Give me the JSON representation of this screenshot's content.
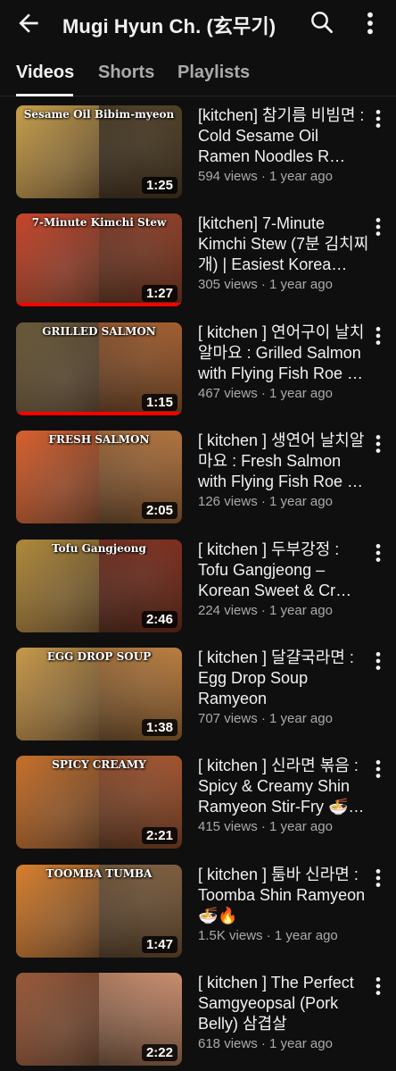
{
  "header": {
    "back_icon": "arrow-back-icon",
    "title": "Mugi Hyun Ch. (玄무기)",
    "search_icon": "search-icon",
    "more_icon": "more-vert-icon"
  },
  "tabs": [
    {
      "label": "Videos",
      "active": true
    },
    {
      "label": "Shorts",
      "active": false
    },
    {
      "label": "Playlists",
      "active": false
    }
  ],
  "videos": [
    {
      "thumb_text": "Sesame Oil Bibim-myeon",
      "duration": "1:25",
      "watched_fraction": 0.0,
      "title": "[kitchen] 참기름 비빔면 : Cold Sesame Oil Ramen Noodles R…",
      "views": "594 views",
      "age": "1 year ago",
      "colors": [
        "#c8a04a",
        "#4a3a22"
      ]
    },
    {
      "thumb_text": "7-Minute Kimchi Stew",
      "duration": "1:27",
      "watched_fraction": 1.0,
      "title": "[kitchen] 7-Minute Kimchi Stew (7분 김치찌개) | Easiest Korea…",
      "views": "305 views",
      "age": "1 year ago",
      "colors": [
        "#c8452a",
        "#8a3a22"
      ]
    },
    {
      "thumb_text": "GRILLED SALMON",
      "duration": "1:15",
      "watched_fraction": 1.0,
      "title": "[ kitchen ] 연어구이 날치알마요 : Grilled Salmon with Flying Fish Roe …",
      "views": "467 views",
      "age": "1 year ago",
      "colors": [
        "#6a5a3a",
        "#a05a2a"
      ]
    },
    {
      "thumb_text": "FRESH SALMON",
      "duration": "2:05",
      "watched_fraction": 0.0,
      "title": "[ kitchen ] 생연어 날치알마요 : Fresh Salmon with Flying Fish Roe …",
      "views": "126 views",
      "age": "1 year ago",
      "colors": [
        "#d9602e",
        "#b0703a"
      ]
    },
    {
      "thumb_text": "Tofu Gangjeong",
      "duration": "2:46",
      "watched_fraction": 0.0,
      "title": "[ kitchen ] 두부강정 : Tofu Gangjeong – Korean Sweet & Cr…",
      "views": "224 views",
      "age": "1 year ago",
      "colors": [
        "#b08a3a",
        "#7a2a1a"
      ]
    },
    {
      "thumb_text": "EGG DROP SOUP",
      "duration": "1:38",
      "watched_fraction": 0.0,
      "title": "[ kitchen ] 달걀국라면 : Egg Drop Soup Ramyeon",
      "views": "707 views",
      "age": "1 year ago",
      "colors": [
        "#c89a4a",
        "#b87a3a"
      ]
    },
    {
      "thumb_text": "SPICY CREAMY",
      "duration": "2:21",
      "watched_fraction": 0.0,
      "title": "[ kitchen ] 신라면 볶음 : Spicy & Creamy Shin Ramyeon Stir-Fry 🍜…",
      "views": "415 views",
      "age": "1 year ago",
      "colors": [
        "#c8702a",
        "#a0502a"
      ]
    },
    {
      "thumb_text": "TOOMBA TUMBA",
      "duration": "1:47",
      "watched_fraction": 0.0,
      "title": "[ kitchen ] 툼바 신라면 : Toomba Shin Ramyeon 🍜🔥",
      "views": "1.5K views",
      "age": "1 year ago",
      "colors": [
        "#d9802e",
        "#7a5a3a"
      ]
    },
    {
      "thumb_text": "",
      "duration": "2:22",
      "watched_fraction": 0.0,
      "title": "[ kitchen ] The Perfect Samgyeopsal (Pork Belly) 삼겹살",
      "views": "618 views",
      "age": "1 year ago",
      "colors": [
        "#9a5a3a",
        "#c88a6a"
      ]
    }
  ],
  "row_more_icon": "more-vert-icon",
  "meta_separator": " · "
}
